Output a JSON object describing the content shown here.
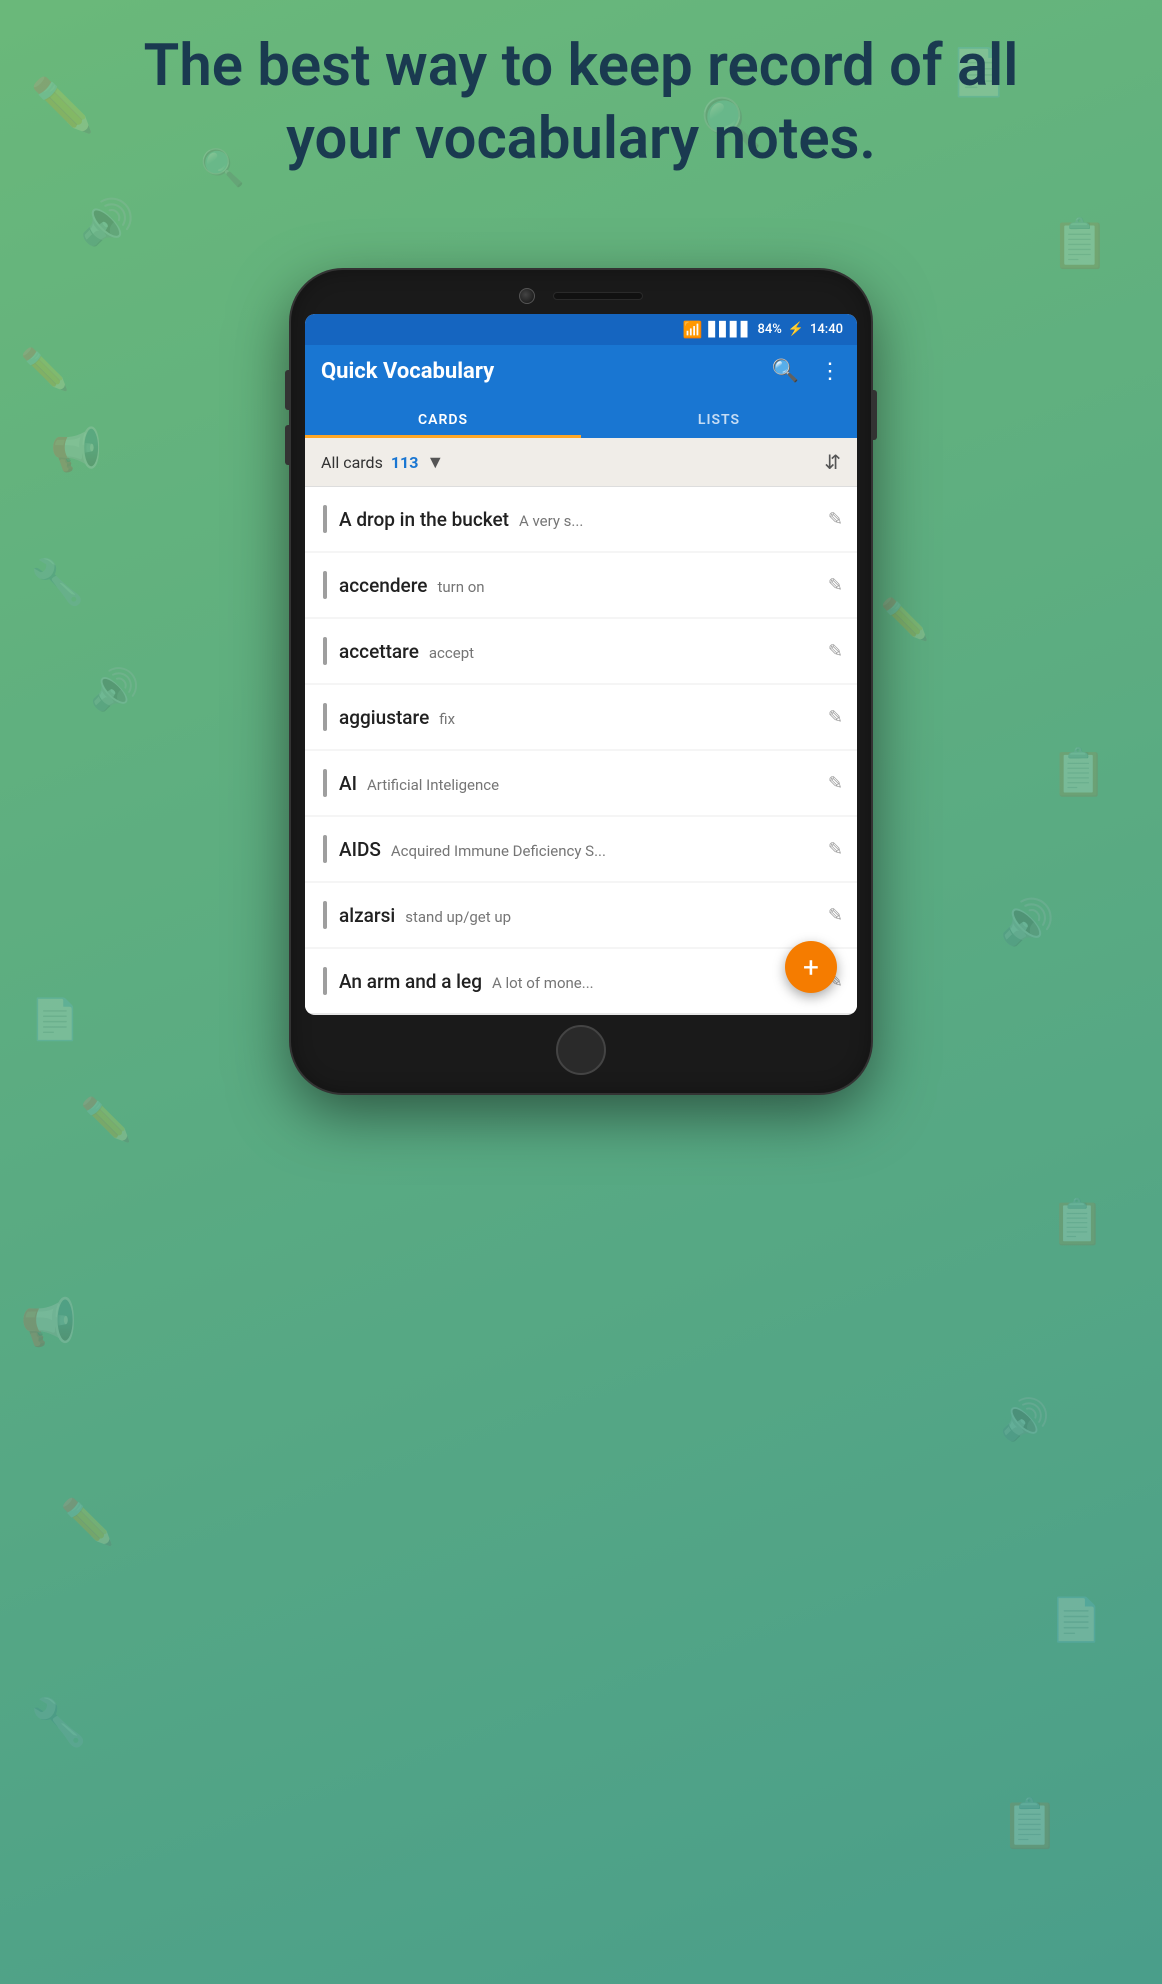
{
  "hero": {
    "text": "The best way to keep record of all your vocabulary notes."
  },
  "status_bar": {
    "wifi": "wifi",
    "signal": "signal",
    "battery": "84%",
    "charging": true,
    "time": "14:40"
  },
  "app_bar": {
    "title": "Quick Vocabulary",
    "search_icon": "search",
    "menu_icon": "more-vert"
  },
  "tabs": [
    {
      "label": "CARDS",
      "active": true
    },
    {
      "label": "LISTS",
      "active": false
    }
  ],
  "toolbar": {
    "label": "All cards",
    "count": "113",
    "sort_label": "sort"
  },
  "cards": [
    {
      "term": "A drop in the bucket",
      "definition": "A very s..."
    },
    {
      "term": "accendere",
      "definition": "turn on"
    },
    {
      "term": "accettare",
      "definition": "accept"
    },
    {
      "term": "aggiustare",
      "definition": "fix"
    },
    {
      "term": "AI",
      "definition": "Artificial Inteligence"
    },
    {
      "term": "AIDS",
      "definition": "Acquired Immune Deficiency S..."
    },
    {
      "term": "alzarsi",
      "definition": "stand up/get up"
    },
    {
      "term": "An arm and a leg",
      "definition": "A lot of mone..."
    }
  ],
  "fab": {
    "label": "+",
    "icon": "add"
  }
}
